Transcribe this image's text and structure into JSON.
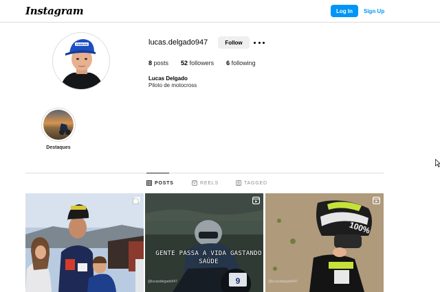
{
  "header": {
    "logo": "Instagram",
    "login_label": "Log In",
    "signup_label": "Sign Up",
    "accent_color": "#0095f6"
  },
  "profile": {
    "username": "lucas.delgado947",
    "follow_label": "Follow",
    "more_icon": "more-horizontal-icon",
    "stats": {
      "posts_count": "8",
      "posts_label": "posts",
      "followers_count": "52",
      "followers_label": "followers",
      "following_count": "6",
      "following_label": "following"
    },
    "full_name": "Lucas Delgado",
    "bio": "Piloto de motocross"
  },
  "highlights": [
    {
      "label": "Destaques"
    }
  ],
  "tabs": [
    {
      "label": "POSTS",
      "icon": "grid-icon",
      "active": true
    },
    {
      "label": "REELS",
      "icon": "reels-icon",
      "active": false
    },
    {
      "label": "TAGGED",
      "icon": "tagged-icon",
      "active": false
    }
  ],
  "posts": [
    {
      "type": "carousel",
      "badge_icon": "carousel-icon"
    },
    {
      "type": "reel",
      "badge_icon": "reel-icon",
      "overlay_text": "GENTE PASSA A VIDA GASTANDO SAÚDE",
      "watermark": "@lucasdelgado947"
    },
    {
      "type": "reel",
      "badge_icon": "reel-icon",
      "watermark": "@lucasdelgado947"
    }
  ]
}
